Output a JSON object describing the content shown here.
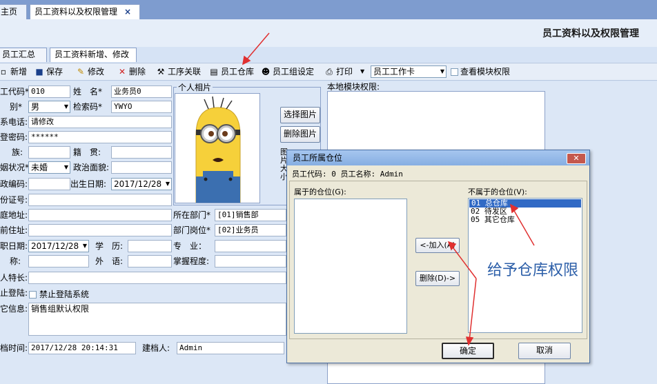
{
  "top_tabs": [
    {
      "label": "主页"
    },
    {
      "label": "员工资料以及权限管理",
      "close": "×"
    }
  ],
  "page_title": "员工资料以及权限管理",
  "sub_tabs": [
    {
      "label": "员工汇总查询"
    },
    {
      "label": "员工资料新增、修改"
    }
  ],
  "toolbar": {
    "new": "新增",
    "save": "保存",
    "edit": "修改",
    "delete": "删除",
    "process": "工序关联",
    "warehouse": "员工仓库",
    "group": "员工组设定",
    "print": "打印",
    "card_select": "员工工作卡",
    "view_module_permission": "查看模块权限"
  },
  "form": {
    "code_label": "工代码*",
    "code_value": "010",
    "name_label": "姓　名*",
    "name_value": "业务员0",
    "gender_label": "别*",
    "gender_value": "男",
    "search_code_label": "检索码*",
    "search_code_value": "YWYO",
    "phone_label": "系电话:",
    "phone_value": "请修改",
    "password_label": "登密码:",
    "password_value": "******",
    "ethnic_label": "族:",
    "native_label": "籍　贯:",
    "marital_label": "姻状况*",
    "marital_value": "未婚",
    "political_label": "政治面貌:",
    "zip_label": "政编码:",
    "birthday_label": "出生日期:",
    "birthday_value": "2017/12/28",
    "id_label": "份证号:",
    "address_label": "庭地址:",
    "dept_label": "所在部门*",
    "dept_value": "[01]销售部",
    "current_address_label": "前住址:",
    "post_label": "部门岗位*",
    "post_value": "[02]业务员",
    "join_date_label": "职日期:",
    "join_date_value": "2017/12/28",
    "education_label": "学　历:",
    "major_label": "专　业：",
    "title_label": "称:",
    "language_label": "外　语:",
    "mastery_label": "掌握程度:",
    "specialty_label": "人特长:",
    "forbid_login_label": "止登陆:",
    "forbid_login_checkbox": "禁止登陆系统",
    "other_info_label": "它信息:",
    "other_info_value": "销售组默认权限",
    "created_time_label": "档时间:",
    "created_time_value": "2017/12/28 20:14:31",
    "creator_label": "建档人:",
    "creator_value": "Admin"
  },
  "photo": {
    "label": "个人相片",
    "select_button": "选择图片",
    "delete_button": "删除图片",
    "side_text": "图片大小"
  },
  "local_permission_label": "本地模块权限:",
  "dialog": {
    "title": "员工所属仓位",
    "close": "✕",
    "info": "员工代码: 0  员工名称: Admin",
    "owned_label": "属于的仓位(G):",
    "not_owned_label": "不属于的仓位(V):",
    "not_owned_items": [
      "01 总仓库",
      "02 待发区",
      "05 其它仓库"
    ],
    "add_button": "<-加入(A)",
    "remove_button": "删除(D)->",
    "ok_button": "确定",
    "cancel_button": "取消"
  },
  "annotation": "给予仓库权限"
}
